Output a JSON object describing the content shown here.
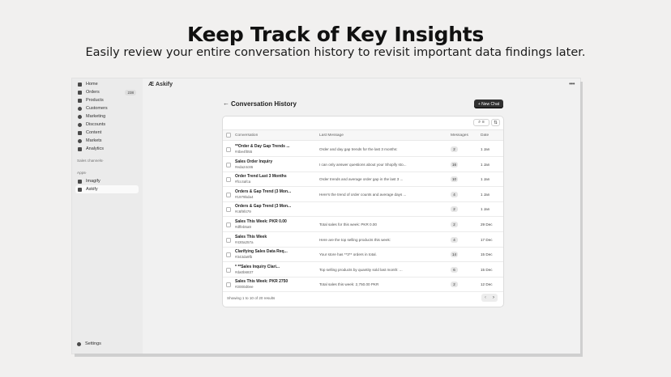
{
  "hero": {
    "title": "Keep Track of Key Insights",
    "subtitle": "Easily review your entire conversation history to revisit important data findings later."
  },
  "sidebar": {
    "items": [
      {
        "label": "Home",
        "icon": "home-icon"
      },
      {
        "label": "Orders",
        "icon": "orders-icon",
        "badge": "238"
      },
      {
        "label": "Products",
        "icon": "tag-icon"
      },
      {
        "label": "Customers",
        "icon": "person-icon"
      },
      {
        "label": "Marketing",
        "icon": "target-icon"
      },
      {
        "label": "Discounts",
        "icon": "discount-icon"
      },
      {
        "label": "Content",
        "icon": "content-icon"
      },
      {
        "label": "Markets",
        "icon": "globe-icon"
      },
      {
        "label": "Analytics",
        "icon": "chart-icon"
      }
    ],
    "sales_channels_label": "Sales channels",
    "apps_label": "Apps",
    "apps": [
      {
        "label": "Imagify",
        "icon": "grid-icon"
      },
      {
        "label": "Askify",
        "icon": "askify-icon"
      }
    ],
    "settings_label": "Settings"
  },
  "app": {
    "name": "Askify",
    "more": "•••"
  },
  "page": {
    "back": "←",
    "title": "Conversation History",
    "new_chat": "+ New Chat"
  },
  "table": {
    "toolbar": {
      "search_filter": "⌕ ≡",
      "sort": "⇅"
    },
    "headers": {
      "conversation": "Conversation",
      "last_message": "Last Message",
      "messages": "Messages",
      "date": "Date"
    },
    "rows": [
      {
        "title": "**Order & Day Gap Trends ...",
        "id": "#4be4f055",
        "last": "Order and day gap trends for the last 3 months:",
        "count": "2",
        "date": "1 Jan"
      },
      {
        "title": "Sales Order Inquiry",
        "id": "#eda24c86",
        "last": "I can only answer questions about your Shopify sto...",
        "count": "16",
        "date": "1 Jan"
      },
      {
        "title": "Order Trend Last 3 Months",
        "id": "#fcc4afca",
        "last": "Order trends and average order gap in the last 3 ...",
        "count": "10",
        "date": "1 Jan"
      },
      {
        "title": "Orders & Gap Trend (3 Mon...",
        "id": "#1979bda4",
        "last": "Here's the trend of order counts and average days ...",
        "count": "4",
        "date": "1 Jan"
      },
      {
        "title": "Orders & Gap Trend (3 Mon...",
        "id": "#c6f9f479",
        "last": "",
        "count": "2",
        "date": "1 Jan"
      },
      {
        "title": "Sales This Week: PKR 0.00",
        "id": "#dffeb5a9",
        "last": "Total sales for this week: PKR 0.00",
        "count": "2",
        "date": "29 Dec"
      },
      {
        "title": "Sales This Week",
        "id": "#430a257a",
        "last": "Here are the top selling products this week:",
        "count": "4",
        "date": "17 Dec"
      },
      {
        "title": "Clarifying Sales Data Req...",
        "id": "#343da9fb",
        "last": "Your store has **3** orders in total.",
        "count": "14",
        "date": "15 Dec"
      },
      {
        "title": "* **Sales Inquiry Clari...",
        "id": "#da0b6837",
        "last": "Top selling products by quantity sold last month: ...",
        "count": "6",
        "date": "15 Dec"
      },
      {
        "title": "Sales This Week: PKR 2750",
        "id": "#2000d0ee",
        "last": "Total sales this week: 2,750.00 PKR",
        "count": "2",
        "date": "12 Dec"
      }
    ],
    "footer": "Showing 1 to 10 of 20 results",
    "pager": {
      "prev": "‹",
      "next": "›"
    }
  }
}
